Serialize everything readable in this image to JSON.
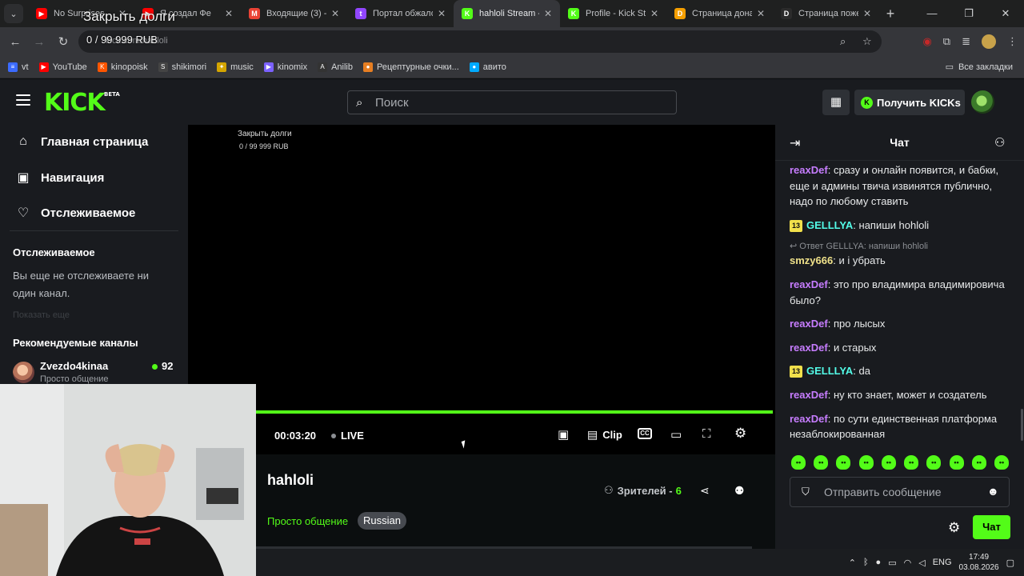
{
  "overlay": {
    "title": "Закрыть долги",
    "amount": "0 / 99 999 RUB"
  },
  "browser": {
    "tabs": [
      {
        "title": "No Surprises",
        "favicon_color": "#ff0000",
        "favicon": "▶"
      },
      {
        "title": "Я создал Фе",
        "favicon_color": "#ff0000",
        "favicon": "▶"
      },
      {
        "title": "Входящие (3) -",
        "favicon_color": "#ea4335",
        "favicon": "M"
      },
      {
        "title": "Портал обжалов",
        "favicon_color": "#9146ff",
        "favicon": "t"
      },
      {
        "title": "hahloli Stream -",
        "favicon_color": "#53fc18",
        "favicon": "K"
      },
      {
        "title": "Profile - Kick Str",
        "favicon_color": "#53fc18",
        "favicon": "K"
      },
      {
        "title": "Страница донат",
        "favicon_color": "#f59f00",
        "favicon": "D"
      },
      {
        "title": "Страница поже",
        "favicon_color": "#2b2b2b",
        "favicon": "D"
      }
    ],
    "active_tab_index": 4,
    "url": "kick.com/hahloli",
    "bookmarks": [
      {
        "label": "vt",
        "icon_color": "#3b6bff",
        "icon": "≡"
      },
      {
        "label": "YouTube",
        "icon_color": "#ff0000",
        "icon": "▶"
      },
      {
        "label": "kinopoisk",
        "icon_color": "#ff5500",
        "icon": "K"
      },
      {
        "label": "shikimori",
        "icon_color": "#444",
        "icon": "S"
      },
      {
        "label": "music",
        "icon_color": "#d4a500",
        "icon": "✦"
      },
      {
        "label": "kinomix",
        "icon_color": "#7b61ff",
        "icon": "▶"
      },
      {
        "label": "Anilib",
        "icon_color": "#333",
        "icon": "A"
      },
      {
        "label": "Рецептурные очки...",
        "icon_color": "#e67e22",
        "icon": "●"
      },
      {
        "label": "авито",
        "icon_color": "#00aaff",
        "icon": "●"
      }
    ],
    "all_bookmarks": "Все закладки"
  },
  "kick": {
    "search_placeholder": "Поиск",
    "get_kicks": "Получить KICKs",
    "logo_badge": "BETA",
    "logo": "KICK",
    "nav": [
      "Главная страница",
      "Навигация",
      "Отслеживаемое"
    ],
    "following_title": "Отслеживаемое",
    "following_empty": "Вы еще не отслеживаете ни один канал.",
    "show_more": "Показать еще",
    "recommended_title": "Рекомендуемые каналы",
    "recommended": [
      {
        "name": "Zvezdo4kinaa",
        "category": "Просто общение",
        "viewers": "92"
      }
    ]
  },
  "player": {
    "time": "00:03:20",
    "live": "LIVE",
    "clip": "Clip",
    "cc": "CC",
    "progress": 1.0
  },
  "stream": {
    "channel": "hahloli",
    "viewers_label": "Зрителей -",
    "viewers": "6",
    "category": "Просто общение",
    "tag": "Russian"
  },
  "chat": {
    "title": "Чат",
    "messages": [
      {
        "user": "reaxDef",
        "color": "#c77dff",
        "text": "сразу и онлайн появится, и бабки, еще и админы твича извинятся публично, надо по любому ставить"
      },
      {
        "user": "GELLLYA",
        "color": "#53fce8",
        "badge": "13",
        "text": "напиши hohloli"
      },
      {
        "reply": "Ответ GELLLYA: напиши hohloli",
        "user": "smzy666",
        "color": "#f0e28a",
        "text": "и i убрать"
      },
      {
        "user": "reaxDef",
        "color": "#c77dff",
        "text": "это про владимира владимировича было?"
      },
      {
        "user": "reaxDef",
        "color": "#c77dff",
        "text": "про лысых"
      },
      {
        "user": "reaxDef",
        "color": "#c77dff",
        "text": "и старых"
      },
      {
        "user": "GELLLYA",
        "color": "#53fce8",
        "badge": "13",
        "text": "da"
      },
      {
        "user": "reaxDef",
        "color": "#c77dff",
        "text": "ну кто знает, может и создатель"
      },
      {
        "user": "reaxDef",
        "color": "#c77dff",
        "text": "по сути единственная платформа незаблокированная"
      }
    ],
    "emotes_count": 10,
    "input_placeholder": "Отправить сообщение",
    "send_label": "Чат"
  },
  "taskbar": {
    "lang": "ENG",
    "time": "17:49",
    "date": "03.08.2026"
  }
}
